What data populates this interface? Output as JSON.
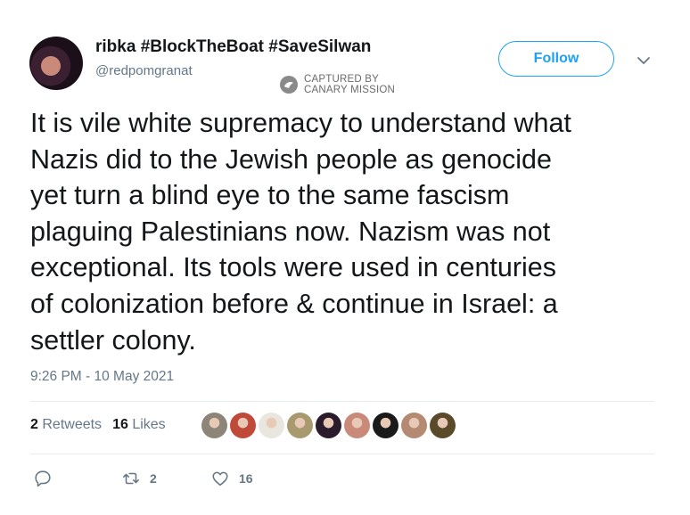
{
  "author": {
    "display_name": "ribka #BlockTheBoat #SaveSilwan",
    "handle": "@redpomgranat"
  },
  "follow_button": {
    "label": "Follow"
  },
  "watermark": {
    "line1": "CAPTURED BY",
    "line2": "CANARY MISSION"
  },
  "tweet": {
    "lines": [
      "It is vile white supremacy to understand what",
      "Nazis did to the Jewish people as genocide",
      "yet turn a blind eye to the same fascism",
      "plaguing Palestinians now. Nazism was not",
      "exceptional. Its tools were used in centuries",
      "of colonization before & continue in Israel: a",
      "settler colony."
    ],
    "timestamp": "9:26 PM - 10 May 2021"
  },
  "stats": {
    "retweets_count": "2",
    "retweets_label": "Retweets",
    "likes_count": "16",
    "likes_label": "Likes"
  },
  "likers_colors": [
    "#8d8577",
    "#c04a3a",
    "#e9e6e0",
    "#a89a6e",
    "#2a1c2a",
    "#c98a7a",
    "#1a1a1a",
    "#b58a72",
    "#5a4a2a"
  ],
  "actions": {
    "reply_count": "",
    "retweet_count": "2",
    "like_count": "16"
  },
  "colors": {
    "accent": "#1da1f2",
    "muted": "#657786",
    "text": "#14171a"
  }
}
